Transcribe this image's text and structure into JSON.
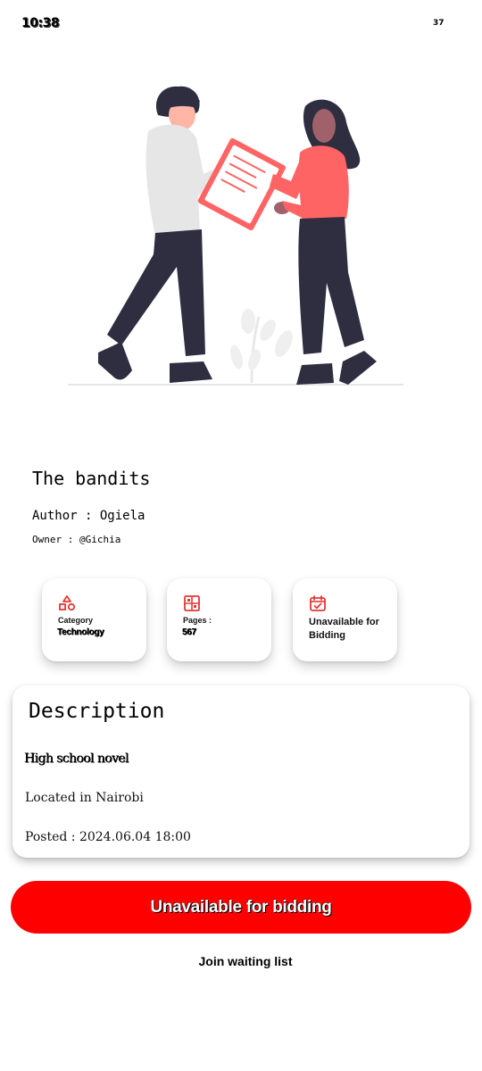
{
  "status_bar": {
    "time": "10:38",
    "battery": "37"
  },
  "book": {
    "title": "The bandits",
    "author_line": "Author : Ogiela",
    "owner_line": "Owner : @Gichia"
  },
  "info_cards": {
    "category": {
      "label": "Category",
      "value": "Technology",
      "icon": "shapes-icon"
    },
    "pages": {
      "label": "Pages :",
      "value": "567",
      "icon": "pages-icon"
    },
    "availability": {
      "text": "Unavailable for Bidding",
      "icon": "calendar-check-icon"
    }
  },
  "description": {
    "title": "Description",
    "line1": "High school novel",
    "line2": "Located in Nairobi",
    "posted": "Posted : 2024.06.04 18:00"
  },
  "actions": {
    "bid_button": "Unavailable for bidding",
    "waiting_list": "Join waiting list"
  },
  "colors": {
    "accent": "#ff0000",
    "icon_red": "#e53935",
    "illustration_coral": "#ff6464",
    "illustration_dark": "#2f2e41"
  }
}
